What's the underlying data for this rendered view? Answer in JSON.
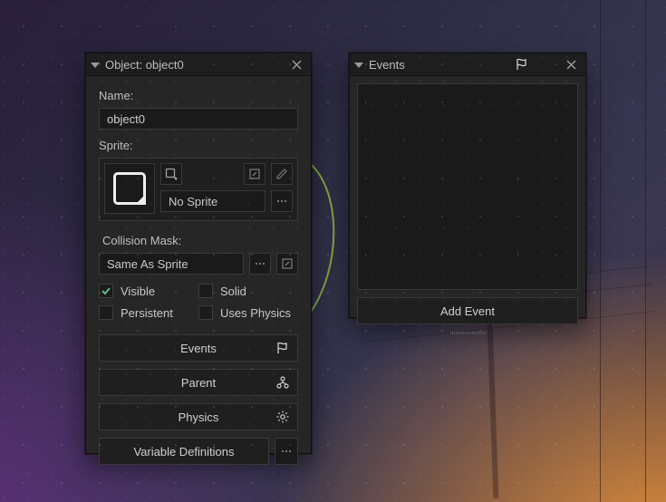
{
  "object_panel": {
    "title": "Object: object0",
    "name_label": "Name:",
    "name_value": "object0",
    "sprite_label": "Sprite:",
    "sprite_selected": "No Sprite",
    "collision_label": "Collision Mask:",
    "collision_value": "Same As Sprite",
    "checkboxes": {
      "visible": {
        "label": "Visible",
        "checked": true
      },
      "solid": {
        "label": "Solid",
        "checked": false
      },
      "persistent": {
        "label": "Persistent",
        "checked": false
      },
      "uses_physics": {
        "label": "Uses Physics",
        "checked": false
      }
    },
    "buttons": {
      "events": "Events",
      "parent": "Parent",
      "physics": "Physics",
      "vardefs": "Variable Definitions"
    }
  },
  "events_panel": {
    "title": "Events",
    "add_event": "Add Event"
  },
  "icons": {
    "collapse": "collapse-triangle",
    "close": "close-icon",
    "flag": "flag-icon",
    "new_sprite": "new-sprite-icon",
    "spanner": "wrench-icon",
    "pencil": "pencil-icon",
    "more": "more-icon",
    "parent": "parent-icon",
    "physics": "gear-icon"
  },
  "colors": {
    "panel_bg": "#262626",
    "field_bg": "#1a1a1a",
    "border": "#3a3a3a",
    "text": "#c9c9c9",
    "accent_check": "#5aa07a"
  }
}
